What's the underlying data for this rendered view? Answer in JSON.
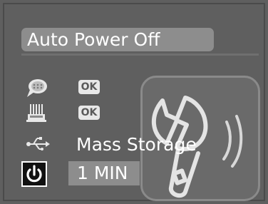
{
  "menu": {
    "title": "Auto Power Off"
  },
  "rows": [
    {
      "icon": "speech-bubble-icon",
      "value": "OK"
    },
    {
      "icon": "printer-icon",
      "value": "OK"
    },
    {
      "icon": "usb-icon",
      "value": "Mass Storage"
    },
    {
      "icon": "power-icon",
      "value": "1 MIN"
    }
  ],
  "panel": {
    "icon": "wrench-icon"
  },
  "colors": {
    "background": "#5f5f5f",
    "title_bar": "#8d8d8d",
    "selection": "#8d8d8d",
    "text": "#ffffff",
    "ok_badge": "#e8e8e8"
  }
}
